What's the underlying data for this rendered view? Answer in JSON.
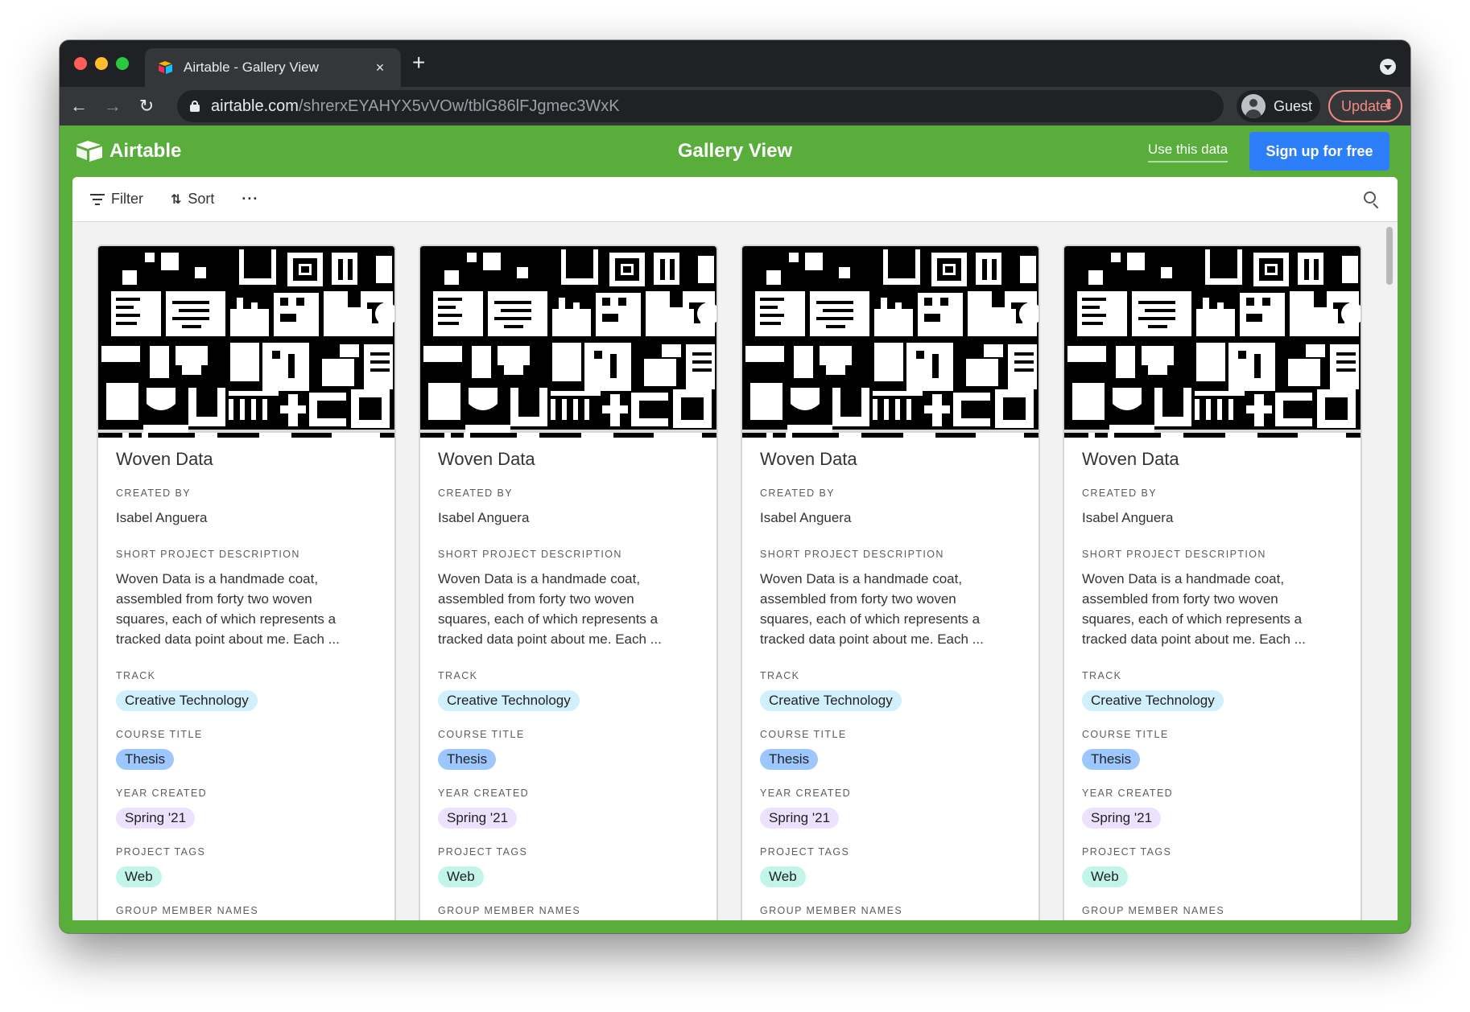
{
  "browser": {
    "tab_title": "Airtable - Gallery View",
    "tab_close": "×",
    "new_tab": "+",
    "url_host": "airtable.com",
    "url_path": "/shrerxEYAHYX5vVOw/tblG86lFJgmec3WxK",
    "profile_name": "Guest",
    "update_label": "Update",
    "back": "←",
    "forward": "→",
    "reload": "↻"
  },
  "app": {
    "logo_text": "Airtable",
    "view_title": "Gallery View",
    "use_data_label": "Use this data",
    "signup_label": "Sign up for free"
  },
  "viewbar": {
    "filter_label": "Filter",
    "sort_label": "Sort",
    "more_label": "···"
  },
  "field_labels": {
    "created_by": "CREATED BY",
    "description": "SHORT PROJECT DESCRIPTION",
    "track": "TRACK",
    "course_title": "COURSE TITLE",
    "year_created": "YEAR CREATED",
    "project_tags": "PROJECT TAGS",
    "group_members": "GROUP MEMBER NAMES"
  },
  "cards": [
    {
      "title": "Woven Data",
      "created_by": "Isabel Anguera",
      "description_lines": [
        "Woven Data is a handmade coat,",
        "assembled from forty two woven",
        "squares, each of which represents a",
        "tracked data point about me. Each ..."
      ],
      "track": "Creative Technology",
      "course_title": "Thesis",
      "year_created": "Spring '21",
      "project_tags": "Web"
    },
    {
      "title": "Woven Data",
      "created_by": "Isabel Anguera",
      "description_lines": [
        "Woven Data is a handmade coat,",
        "assembled from forty two woven",
        "squares, each of which represents a",
        "tracked data point about me. Each ..."
      ],
      "track": "Creative Technology",
      "course_title": "Thesis",
      "year_created": "Spring '21",
      "project_tags": "Web"
    },
    {
      "title": "Woven Data",
      "created_by": "Isabel Anguera",
      "description_lines": [
        "Woven Data is a handmade coat,",
        "assembled from forty two woven",
        "squares, each of which represents a",
        "tracked data point about me. Each ..."
      ],
      "track": "Creative Technology",
      "course_title": "Thesis",
      "year_created": "Spring '21",
      "project_tags": "Web"
    },
    {
      "title": "Woven Data",
      "created_by": "Isabel Anguera",
      "description_lines": [
        "Woven Data is a handmade coat,",
        "assembled from forty two woven",
        "squares, each of which represents a",
        "tracked data point about me. Each ..."
      ],
      "track": "Creative Technology",
      "course_title": "Thesis",
      "year_created": "Spring '21",
      "project_tags": "Web"
    }
  ],
  "colors": {
    "brand_green": "#59ad3b",
    "signup_blue": "#2d7ff9",
    "update_red": "#f28b82",
    "pill_track": "#d0f0fd",
    "pill_course": "#9cc7ff",
    "pill_year": "#ede2fe",
    "pill_tags": "#c2f5e9"
  }
}
